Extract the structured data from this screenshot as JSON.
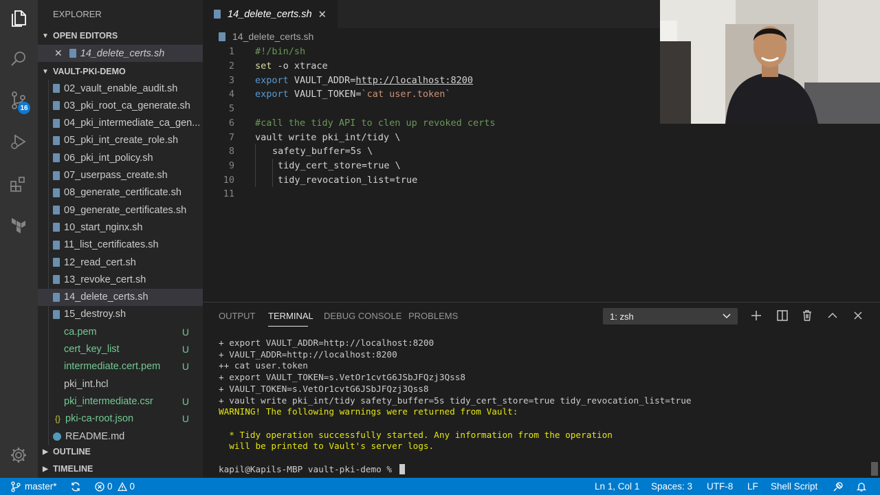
{
  "sidebar": {
    "title": "EXPLORER",
    "open_editors_label": "OPEN EDITORS",
    "open_editor_file": "14_delete_certs.sh",
    "project_label": "VAULT-PKI-DEMO",
    "files": [
      {
        "name": "02_vault_enable_audit.sh",
        "status": ""
      },
      {
        "name": "03_pki_root_ca_generate.sh",
        "status": ""
      },
      {
        "name": "04_pki_intermediate_ca_gen...",
        "status": ""
      },
      {
        "name": "05_pki_int_create_role.sh",
        "status": ""
      },
      {
        "name": "06_pki_int_policy.sh",
        "status": ""
      },
      {
        "name": "07_userpass_create.sh",
        "status": ""
      },
      {
        "name": "08_generate_certificate.sh",
        "status": ""
      },
      {
        "name": "09_generate_certificates.sh",
        "status": ""
      },
      {
        "name": "10_start_nginx.sh",
        "status": ""
      },
      {
        "name": "11_list_certificates.sh",
        "status": ""
      },
      {
        "name": "12_read_cert.sh",
        "status": ""
      },
      {
        "name": "13_revoke_cert.sh",
        "status": ""
      },
      {
        "name": "14_delete_certs.sh",
        "status": ""
      },
      {
        "name": "15_destroy.sh",
        "status": ""
      },
      {
        "name": "ca.pem",
        "status": "U"
      },
      {
        "name": "cert_key_list",
        "status": "U"
      },
      {
        "name": "intermediate.cert.pem",
        "status": "U"
      },
      {
        "name": "pki_int.hcl",
        "status": ""
      },
      {
        "name": "pki_intermediate.csr",
        "status": "U"
      },
      {
        "name": "pki-ca-root.json",
        "status": "U"
      },
      {
        "name": "README.md",
        "status": ""
      }
    ],
    "outline_label": "OUTLINE",
    "timeline_label": "TIMELINE"
  },
  "activity": {
    "scm_badge": "16"
  },
  "editor": {
    "tab_label": "14_delete_certs.sh",
    "breadcrumb": "14_delete_certs.sh",
    "line_numbers": [
      "1",
      "2",
      "3",
      "4",
      "5",
      "6",
      "7",
      "8",
      "9",
      "10",
      "11"
    ],
    "code": {
      "l1": "#!/bin/sh",
      "l2_kw": "set",
      "l2_rest": " -o xtrace",
      "l3_kw": "export",
      "l3_var": " VAULT_ADDR=",
      "l3_val": "http://localhost:8200",
      "l4_kw": "export",
      "l4_var": " VAULT_TOKEN=",
      "l4_val": "`cat user.token`",
      "l6": "#call the tidy API to clen up revoked certs",
      "l7": "vault write pki_int/tidy \\",
      "l8": "safety_buffer=5s \\",
      "l9": "tidy_cert_store=true \\",
      "l10": "tidy_revocation_list=true"
    }
  },
  "panel": {
    "tabs": [
      "OUTPUT",
      "TERMINAL",
      "DEBUG CONSOLE",
      "PROBLEMS"
    ],
    "terminal_select": "1: zsh",
    "terminal_lines": [
      "+ export VAULT_ADDR=http://localhost:8200",
      "+ VAULT_ADDR=http://localhost:8200",
      "++ cat user.token",
      "+ export VAULT_TOKEN=s.VetOr1cvtG6JSbJFQzj3Qss8",
      "+ VAULT_TOKEN=s.VetOr1cvtG6JSbJFQzj3Qss8",
      "+ vault write pki_int/tidy safety_buffer=5s tidy_cert_store=true tidy_revocation_list=true",
      "WARNING! The following warnings were returned from Vault:",
      "",
      "  * Tidy operation successfully started. Any information from the operation",
      "  will be printed to Vault's server logs.",
      "",
      "kapil@Kapils-MBP vault-pki-demo % "
    ]
  },
  "statusbar": {
    "branch": "master*",
    "errors": "0",
    "warnings": "0",
    "position": "Ln 1, Col 1",
    "spaces": "Spaces: 3",
    "encoding": "UTF-8",
    "eol": "LF",
    "language": "Shell Script"
  },
  "colors": {
    "accent": "#007acc",
    "untracked": "#73c991",
    "warning": "#e5e510"
  }
}
